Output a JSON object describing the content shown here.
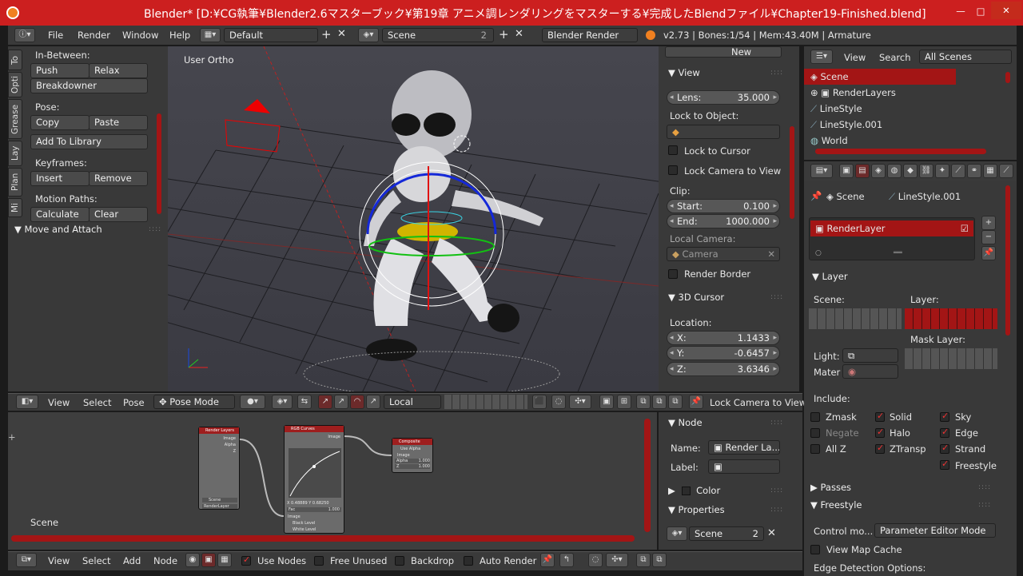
{
  "window": {
    "title": "Blender* [D:¥CG執筆¥Blender2.6マスターブック¥第19章 アニメ調レンダリングをマスターする¥完成したBlendファイル¥Chapter19-Finished.blend]"
  },
  "info_header": {
    "menus": [
      "File",
      "Render",
      "Window",
      "Help"
    ],
    "layout": "Default",
    "scene": "Scene",
    "scene_count": "2",
    "engine": "Blender Render",
    "stats": "v2.73 | Bones:1/54 | Mem:43.40M | Armature"
  },
  "toolshelf": {
    "tabs": [
      "To",
      "Opti",
      "Grease",
      "Lay",
      "Plan",
      "Mi"
    ],
    "in_between": "In-Between:",
    "push": "Push",
    "relax": "Relax",
    "breakdowner": "Breakdowner",
    "pose": "Pose:",
    "copy": "Copy",
    "paste": "Paste",
    "add_to_library": "Add To Library",
    "keyframes": "Keyframes:",
    "insert": "Insert",
    "remove": "Remove",
    "motion_paths": "Motion Paths:",
    "calculate": "Calculate",
    "clear": "Clear",
    "move_attach": "Move and Attach"
  },
  "viewport": {
    "label": "User Ortho"
  },
  "view3d_header": {
    "view": "View",
    "select": "Select",
    "pose": "Pose",
    "mode": "Pose Mode",
    "orientation": "Local",
    "lock_camera": "Lock Camera to View"
  },
  "npanel": {
    "new": "New",
    "view_title": "View",
    "lens_label": "Lens:",
    "lens": "35.000",
    "lock_object": "Lock to Object:",
    "lock_cursor": "Lock to Cursor",
    "lock_camera": "Lock Camera to View",
    "clip": "Clip:",
    "start_label": "Start:",
    "start": "0.100",
    "end_label": "End:",
    "end": "1000.000",
    "local_camera": "Local Camera:",
    "camera": "Camera",
    "render_border": "Render Border",
    "cursor_title": "3D Cursor",
    "location": "Location:",
    "x_label": "X:",
    "x": "1.1433",
    "y_label": "Y:",
    "y": "-0.6457",
    "z_label": "Z:",
    "z": "3.6346"
  },
  "outliner": {
    "view": "View",
    "search": "Search",
    "filter": "All Scenes",
    "items": [
      "Scene",
      "RenderLayers",
      "LineStyle",
      "LineStyle.001",
      "World"
    ]
  },
  "properties": {
    "crumb_scene": "Scene",
    "crumb_style": "LineStyle.001",
    "render_layer": "RenderLayer",
    "layer_title": "Layer",
    "scene_label": "Scene:",
    "layer_label": "Layer:",
    "mask_layer": "Mask Layer:",
    "light": "Light:",
    "mater": "Mater",
    "include": "Include:",
    "zmask": "Zmask",
    "solid": "Solid",
    "sky": "Sky",
    "negate": "Negate",
    "halo": "Halo",
    "edge": "Edge",
    "allz": "All Z",
    "ztransp": "ZTransp",
    "strand": "Strand",
    "freestyle_cb": "Freestyle",
    "passes": "Passes",
    "freestyle": "Freestyle",
    "control_mode_label": "Control mo...",
    "control_mode": "Parameter Editor Mode",
    "view_map_cache": "View Map Cache",
    "edge_detection": "Edge Detection Options:"
  },
  "node_editor": {
    "scene_label": "Scene",
    "render_layers": "Render Layers",
    "image": "Image",
    "alpha": "Alpha",
    "z": "Z",
    "scene_small": "Scene",
    "renderlayer_small": "RenderLayer",
    "rgb_curves": "RGB Curves",
    "fac": "Fac",
    "black_level": "Black Level",
    "white_level": "White Level",
    "curve_readout": "X 0.48889  Y 0.68250",
    "curve_fac": "1.000",
    "composite": "Composite",
    "use_alpha": "Use Alpha",
    "alpha_val": "1.000",
    "z_val": "1.000"
  },
  "node_header": {
    "view": "View",
    "select": "Select",
    "add": "Add",
    "node": "Node",
    "use_nodes": "Use Nodes",
    "free_unused": "Free Unused",
    "backdrop": "Backdrop",
    "auto_render": "Auto Render"
  },
  "node_npanel": {
    "node_title": "Node",
    "name_label": "Name:",
    "name": "Render La...",
    "label_label": "Label:",
    "color": "Color",
    "properties": "Properties",
    "scene": "Scene",
    "scene_count": "2"
  },
  "colors": {
    "accent": "#a31515",
    "panel": "#3a3a3a",
    "viewport": "#3d3d45"
  }
}
